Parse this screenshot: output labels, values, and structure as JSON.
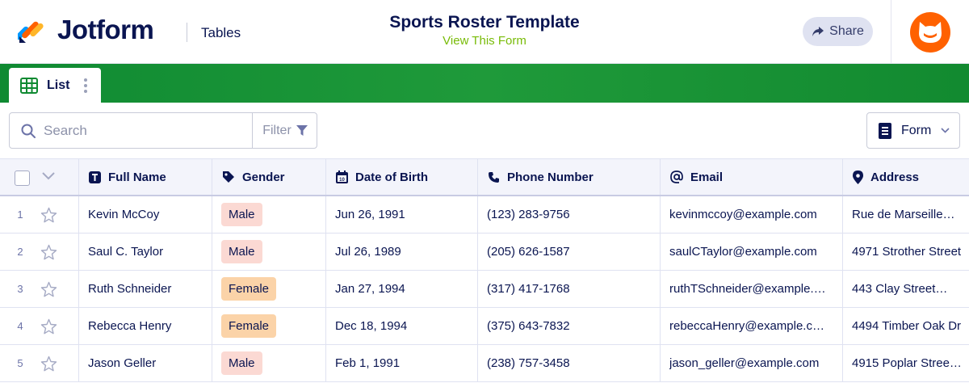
{
  "header": {
    "brand": "Jotform",
    "tables_link": "Tables",
    "title": "Sports Roster Template",
    "view_form": "View This Form",
    "share_label": "Share"
  },
  "tabs": [
    {
      "label": "List",
      "icon": "grid-icon"
    }
  ],
  "toolbar": {
    "search_placeholder": "Search",
    "filter_label": "Filter",
    "form_label": "Form"
  },
  "colors": {
    "brand_green": "#1f9a3a",
    "link_green": "#78bb07",
    "avatar_orange": "#ff6100",
    "male_badge": "#fbd9d3",
    "female_badge": "#fbd3a8"
  },
  "table": {
    "columns": [
      {
        "label": "Full Name",
        "icon": "text-icon"
      },
      {
        "label": "Gender",
        "icon": "tag-icon"
      },
      {
        "label": "Date of Birth",
        "icon": "calendar-icon"
      },
      {
        "label": "Phone Number",
        "icon": "phone-icon"
      },
      {
        "label": "Email",
        "icon": "at-icon"
      },
      {
        "label": "Address",
        "icon": "location-pin-icon"
      }
    ],
    "rows": [
      {
        "num": "1",
        "name": "Kevin McCoy",
        "gender": "Male",
        "dob": "Jun 26, 1991",
        "phone": "(123) 283-9756",
        "email": "kevinmccoy@example.com",
        "address": "Rue de Marseille…"
      },
      {
        "num": "2",
        "name": "Saul C. Taylor",
        "gender": "Male",
        "dob": "Jul 26, 1989",
        "phone": "(205) 626-1587",
        "email": "saulCTaylor@example.com",
        "address": "4971 Strother Street"
      },
      {
        "num": "3",
        "name": "Ruth Schneider",
        "gender": "Female",
        "dob": "Jan 27, 1994",
        "phone": "(317) 417-1768",
        "email": "ruthTSchneider@example.…",
        "address": "443 Clay Street…"
      },
      {
        "num": "4",
        "name": "Rebecca Henry",
        "gender": "Female",
        "dob": "Dec 18, 1994",
        "phone": "(375) 643-7832",
        "email": "rebeccaHenry@example.c…",
        "address": "4494 Timber Oak Dr"
      },
      {
        "num": "5",
        "name": "Jason Geller",
        "gender": "Male",
        "dob": "Feb 1, 1991",
        "phone": "(238) 757-3458",
        "email": "jason_geller@example.com",
        "address": "4915 Poplar Street…"
      }
    ]
  }
}
